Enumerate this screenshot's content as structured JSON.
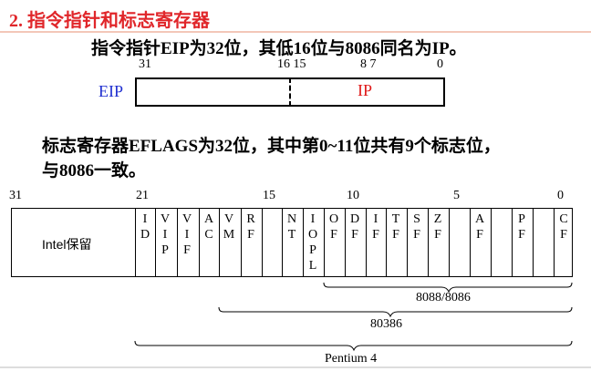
{
  "title": "2. 指令指针和标志寄存器",
  "eip": {
    "description": "指令指针EIP为32位，其低16位与8086同名为IP。",
    "ticks": [
      "31",
      "16 15",
      "8 7",
      "0"
    ],
    "label": "EIP",
    "low_label": "IP",
    "label_color": "#1f2fd0",
    "low_label_color": "#e01818"
  },
  "eflags": {
    "description_line1": "标志寄存器EFLAGS为32位，其中第0~11位共有9个标志位，",
    "description_line2": "与8086一致。",
    "bit_ticks": [
      "31",
      "21",
      "15",
      "10",
      "5",
      "0"
    ],
    "reserved_label": "Intel保留",
    "flags": [
      "ID",
      "VIP",
      "VIF",
      "AC",
      "VM",
      "RF",
      "NT",
      "IOPL",
      "OF",
      "DF",
      "IF",
      "TF",
      "SF",
      "ZF",
      "AF",
      "PF",
      "CF"
    ],
    "groups": [
      "8088/8086",
      "80386",
      "Pentium 4"
    ]
  },
  "colors": {
    "title": "#e0262a",
    "title_rule": "#f3c7b8"
  }
}
